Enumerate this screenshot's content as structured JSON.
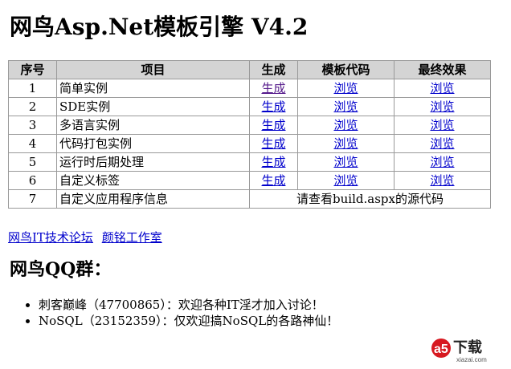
{
  "page": {
    "title": "网鸟Asp.Net模板引擎  V4.2"
  },
  "table": {
    "headers": [
      "序号",
      "项目",
      "生成",
      "模板代码",
      "最终效果"
    ],
    "rows": [
      {
        "num": "1",
        "item": "简单实例",
        "gen": "生成",
        "tpl": "浏览",
        "res": "浏览"
      },
      {
        "num": "2",
        "item": "SDE实例",
        "gen": "生成",
        "tpl": "浏览",
        "res": "浏览"
      },
      {
        "num": "3",
        "item": "多语言实例",
        "gen": "生成",
        "tpl": "浏览",
        "res": "浏览"
      },
      {
        "num": "4",
        "item": "代码打包实例",
        "gen": "生成",
        "tpl": "浏览",
        "res": "浏览"
      },
      {
        "num": "5",
        "item": "运行时后期处理",
        "gen": "生成",
        "tpl": "浏览",
        "res": "浏览"
      },
      {
        "num": "6",
        "item": "自定义标签",
        "gen": "生成",
        "tpl": "浏览",
        "res": "浏览"
      }
    ],
    "last_row": {
      "num": "7",
      "item": "自定义应用程序信息",
      "note": "请查看build.aspx的源代码"
    }
  },
  "links": {
    "forum": "网鸟IT技术论坛",
    "studio": "颜铭工作室"
  },
  "qq": {
    "heading": "网鸟QQ群：",
    "groups": [
      "刺客巅峰（47700865）：欢迎各种IT淫才加入讨论！",
      "NoSQL（23152359）：仅欢迎搞NoSQL的各路神仙！"
    ]
  },
  "watermark": {
    "logo_letter": "a5",
    "logo_text": "下载",
    "site": "xiazai.com"
  },
  "colors": {
    "header_bg": "#d4d4d4",
    "link": "#0000cc",
    "visited_link": "#551a8b",
    "watermark_red": "#d71920"
  }
}
